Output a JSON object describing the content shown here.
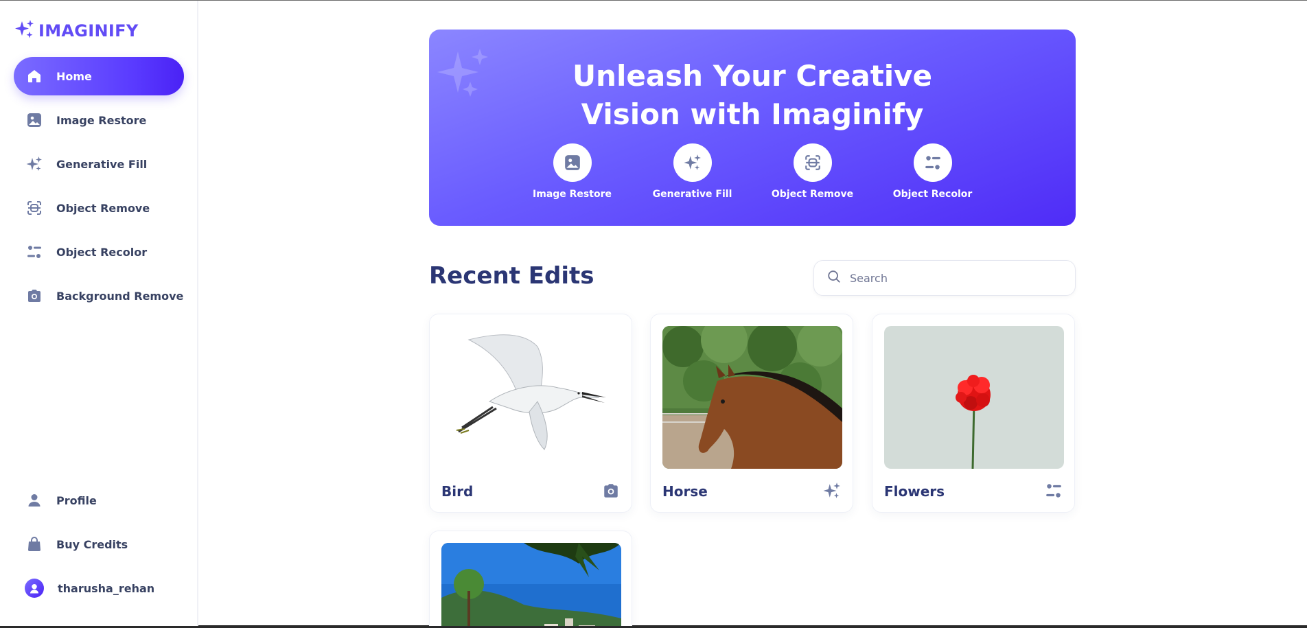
{
  "app": {
    "name": "IMAGINIFY",
    "brand_color": "#624cf5",
    "text_color": "#384262"
  },
  "sidebar": {
    "items": [
      {
        "label": "Home",
        "icon": "home-icon",
        "active": true
      },
      {
        "label": "Image Restore",
        "icon": "image-icon",
        "active": false
      },
      {
        "label": "Generative Fill",
        "icon": "stars-icon",
        "active": false
      },
      {
        "label": "Object Remove",
        "icon": "scan-icon",
        "active": false
      },
      {
        "label": "Object Recolor",
        "icon": "filter-icon",
        "active": false
      },
      {
        "label": "Background Remove",
        "icon": "camera-icon",
        "active": false
      }
    ],
    "bottom": [
      {
        "label": "Profile",
        "icon": "user-icon"
      },
      {
        "label": "Buy Credits",
        "icon": "bag-icon"
      }
    ],
    "user": {
      "username": "tharusha_rehan"
    }
  },
  "banner": {
    "title_line1": "Unleash Your Creative",
    "title_line2": "Vision with Imaginify",
    "links": [
      {
        "label": "Image Restore",
        "icon": "image-icon"
      },
      {
        "label": "Generative Fill",
        "icon": "stars-icon"
      },
      {
        "label": "Object Remove",
        "icon": "scan-icon"
      },
      {
        "label": "Object Recolor",
        "icon": "filter-icon"
      }
    ]
  },
  "recent": {
    "title": "Recent Edits",
    "search_placeholder": "Search",
    "cards": [
      {
        "title": "Bird",
        "type_icon": "camera-icon"
      },
      {
        "title": "Horse",
        "type_icon": "stars-icon"
      },
      {
        "title": "Flowers",
        "type_icon": "filter-icon"
      },
      {
        "title": "",
        "type_icon": ""
      }
    ]
  }
}
